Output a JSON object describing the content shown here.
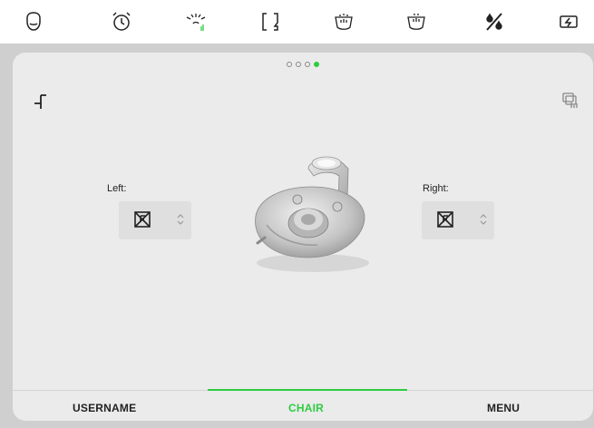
{
  "toolbar": {
    "icons": [
      "face-icon",
      "alarm-clock-icon",
      "light-spray-icon",
      "bracket-frame-icon",
      "mouth-upper-icon",
      "mouth-lower-icon",
      "no-water-icon",
      "battery-icon"
    ]
  },
  "pager": {
    "count": 4,
    "active_index": 3
  },
  "left": {
    "label": "Left:"
  },
  "right": {
    "label": "Right:"
  },
  "tabs": [
    {
      "label": "USERNAME",
      "active": false
    },
    {
      "label": "CHAIR",
      "active": true
    },
    {
      "label": "MENU",
      "active": false
    }
  ],
  "colors": {
    "accent": "#2ecc40",
    "panel": "#ebebeb",
    "background": "#cfcfcf"
  }
}
